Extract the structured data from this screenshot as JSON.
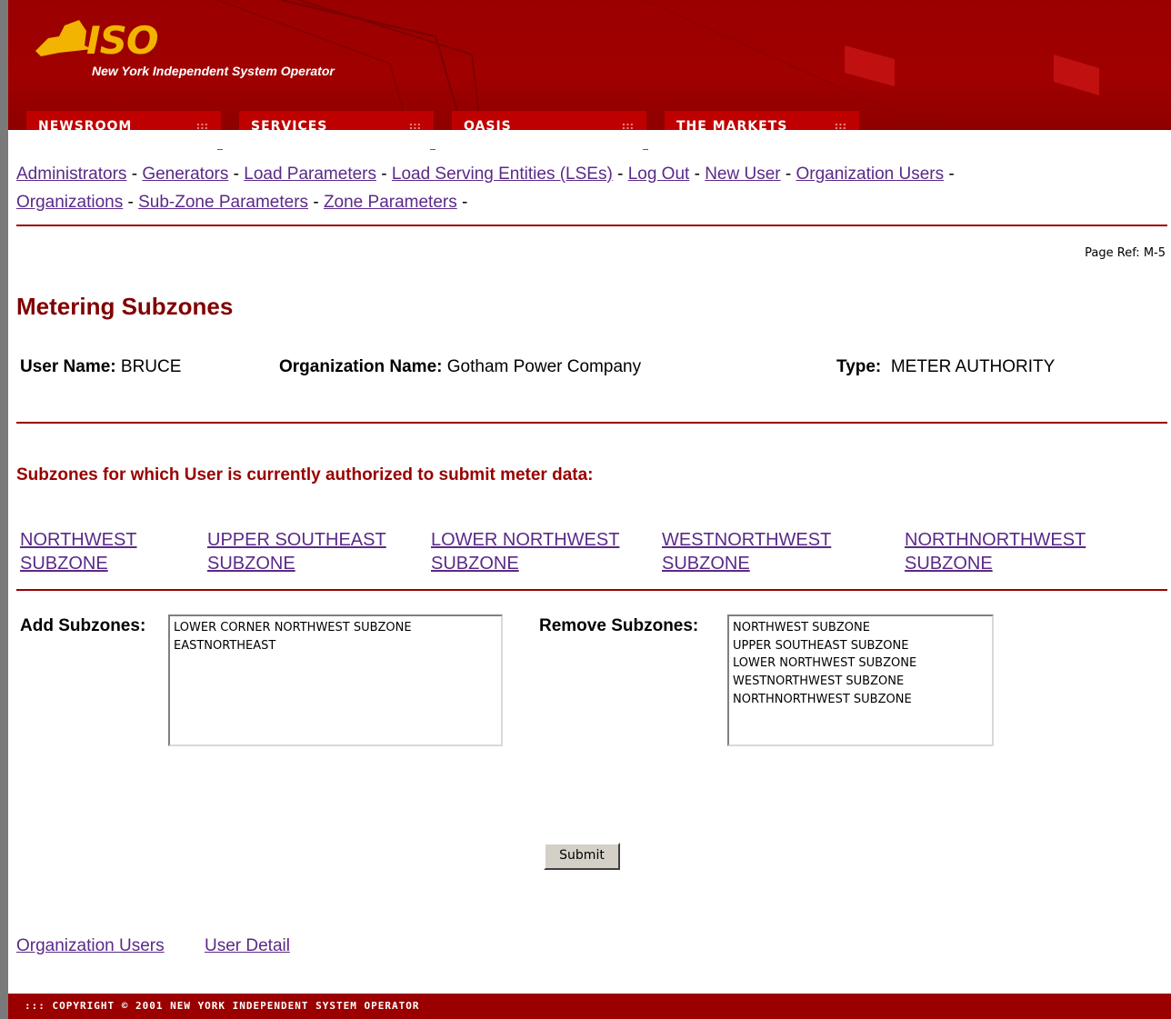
{
  "header": {
    "logo_text": "ISO",
    "logo_subtitle": "New York Independent System Operator",
    "tabs": [
      {
        "label": "NEWSROOM"
      },
      {
        "label": "SERVICES"
      },
      {
        "label": "OASIS"
      },
      {
        "label": "THE MARKETS"
      }
    ]
  },
  "nav": {
    "links": [
      "Administrators",
      "Generators",
      "Load Parameters",
      "Load Serving Entities (LSEs)",
      "Log Out",
      "New User",
      "Organization Users",
      "Organizations",
      "Sub-Zone Parameters",
      "Zone Parameters"
    ],
    "separator": "-"
  },
  "page_ref": "Page Ref: M-5",
  "title": "Metering Subzones",
  "user_info": {
    "user_name_label": "User Name:",
    "user_name": "BRUCE",
    "org_label": "Organization Name:",
    "org_name": "Gotham Power Company",
    "type_label": "Type:",
    "type": "METER AUTHORITY"
  },
  "authorized_heading": "Subzones for which User is currently authorized to submit meter data:",
  "authorized_subzones": [
    {
      "line1": "NORTHWEST",
      "line2": "SUBZONE"
    },
    {
      "line1": "UPPER SOUTHEAST",
      "line2": "SUBZONE"
    },
    {
      "line1": "LOWER NORTHWEST",
      "line2": "SUBZONE"
    },
    {
      "line1": "WESTNORTHWEST",
      "line2": "SUBZONE"
    },
    {
      "line1": "NORTHNORTHWEST",
      "line2": "SUBZONE"
    }
  ],
  "add_label": "Add Subzones:",
  "add_options": [
    "LOWER CORNER NORTHWEST SUBZONE",
    "EASTNORTHEAST"
  ],
  "remove_label": "Remove Subzones:",
  "remove_options": [
    "NORTHWEST SUBZONE",
    "UPPER SOUTHEAST SUBZONE",
    "LOWER NORTHWEST SUBZONE",
    "WESTNORTHWEST SUBZONE",
    "NORTHNORTHWEST SUBZONE"
  ],
  "submit_label": "Submit",
  "bottom_links": [
    "Organization Users",
    "User Detail"
  ],
  "footer": "::: COPYRIGHT © 2001 NEW YORK INDEPENDENT SYSTEM OPERATOR",
  "colors": {
    "brand_red": "#9b0000",
    "logo_gold": "#f2b400",
    "link": "#5a2a88",
    "heading": "#800000"
  }
}
